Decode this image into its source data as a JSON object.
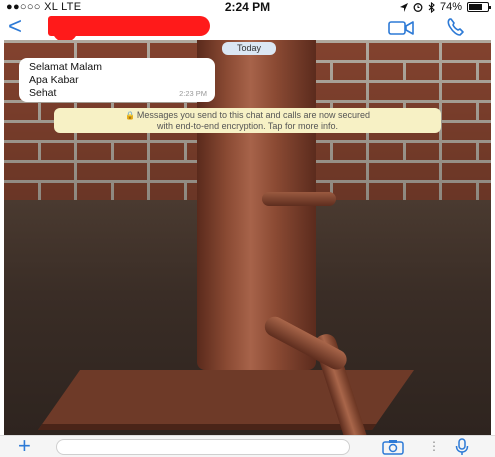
{
  "status_bar": {
    "carrier": "●●○○○ XL  LTE",
    "time": "2:24 PM",
    "battery": "74%",
    "battery_level": 0.74,
    "icons": [
      "location-icon",
      "alarm-icon",
      "bluetooth-icon",
      "battery-icon"
    ]
  },
  "nav": {
    "back_icon": "chevron-left-icon",
    "contact_redacted": true,
    "actions": [
      "video-call-icon",
      "phone-call-icon"
    ],
    "accent_color": "#2d7ad6"
  },
  "chat": {
    "date_label": "Today",
    "messages": [
      {
        "lines": [
          "Selamat Malam",
          "Apa Kabar",
          "Sehat"
        ],
        "time": "2:23 PM"
      }
    ],
    "encryption_notice_line1": "Messages you send to this chat and calls are now secured",
    "encryption_notice_line2": "with end-to-end encryption. Tap for more info."
  },
  "input_bar": {
    "plus_icon": "plus-icon",
    "placeholder": "",
    "icons": [
      "camera-icon",
      "more-dots-icon",
      "microphone-icon"
    ]
  }
}
